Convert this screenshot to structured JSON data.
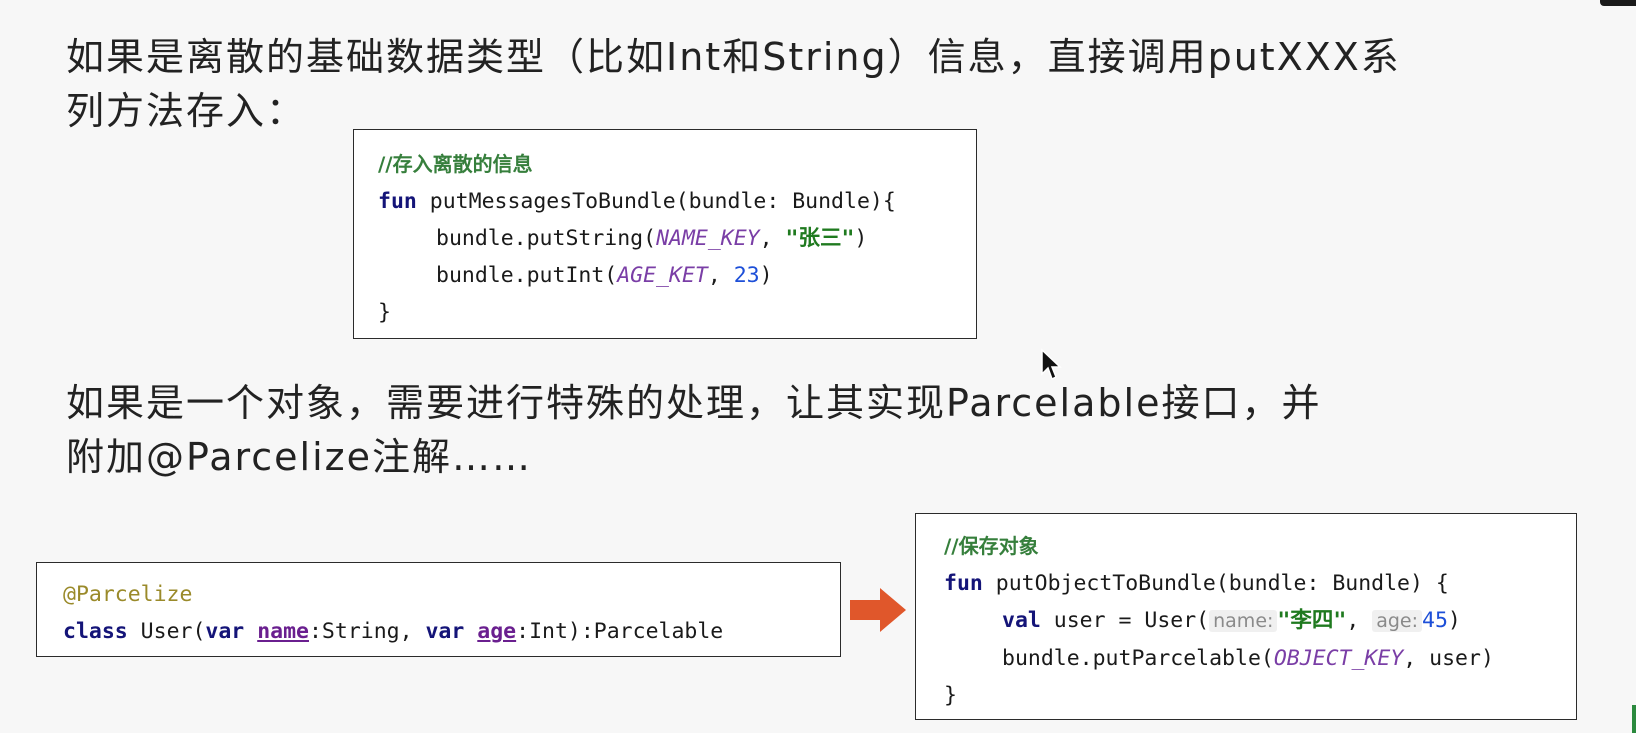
{
  "para1": {
    "line1": "如果是离散的基础数据类型（比如Int和String）信息，直接调用putXXX系",
    "line2": "列方法存入："
  },
  "code1": {
    "comment": "//存入离散的信息",
    "kw_fun": "fun",
    "signature": " putMessagesToBundle(bundle: Bundle){",
    "line2_pre": "bundle.putString(",
    "line2_const": "NAME_KEY",
    "line2_sep": ", ",
    "line2_str": "\"张三\"",
    "line2_end": ")",
    "line3_pre": "bundle.putInt(",
    "line3_const": "AGE_KET",
    "line3_sep": ", ",
    "line3_num": "23",
    "line3_end": ")",
    "close": "}"
  },
  "para2": {
    "line1": "如果是一个对象，需要进行特殊的处理，让其实现Parcelable接口，并",
    "line2": "附加@Parcelize注解……"
  },
  "code2": {
    "annotation": "@Parcelize",
    "kw_class": "class",
    "cls_name": " User(",
    "kw_var1": "var",
    "sp1": " ",
    "prop1": "name",
    "type1": ":String, ",
    "kw_var2": "var",
    "sp2": " ",
    "prop2": "age",
    "type2": ":Int):Parcelable"
  },
  "code3": {
    "comment": "//保存对象",
    "kw_fun": "fun",
    "signature": " putObjectToBundle(bundle: Bundle) {",
    "kw_val": "val",
    "val_pre": " user = User(",
    "hint_name": "name:",
    "str_name": "\"李四\"",
    "sep": ", ",
    "hint_age": "age:",
    "num_age": "45",
    "val_end": ")",
    "line3_pre": "bundle.putParcelable(",
    "line3_const": "OBJECT_KEY",
    "line3_end": ", user)",
    "close": "}"
  },
  "icons": {
    "arrow": "right-arrow-icon",
    "cursor": "mouse-cursor-icon"
  },
  "colors": {
    "arrow": "#e0572b",
    "comment": "#367f3c",
    "keyword": "#141478",
    "constant": "#7a3ea6",
    "string": "#1f7a1f",
    "number": "#1d4fd8"
  }
}
